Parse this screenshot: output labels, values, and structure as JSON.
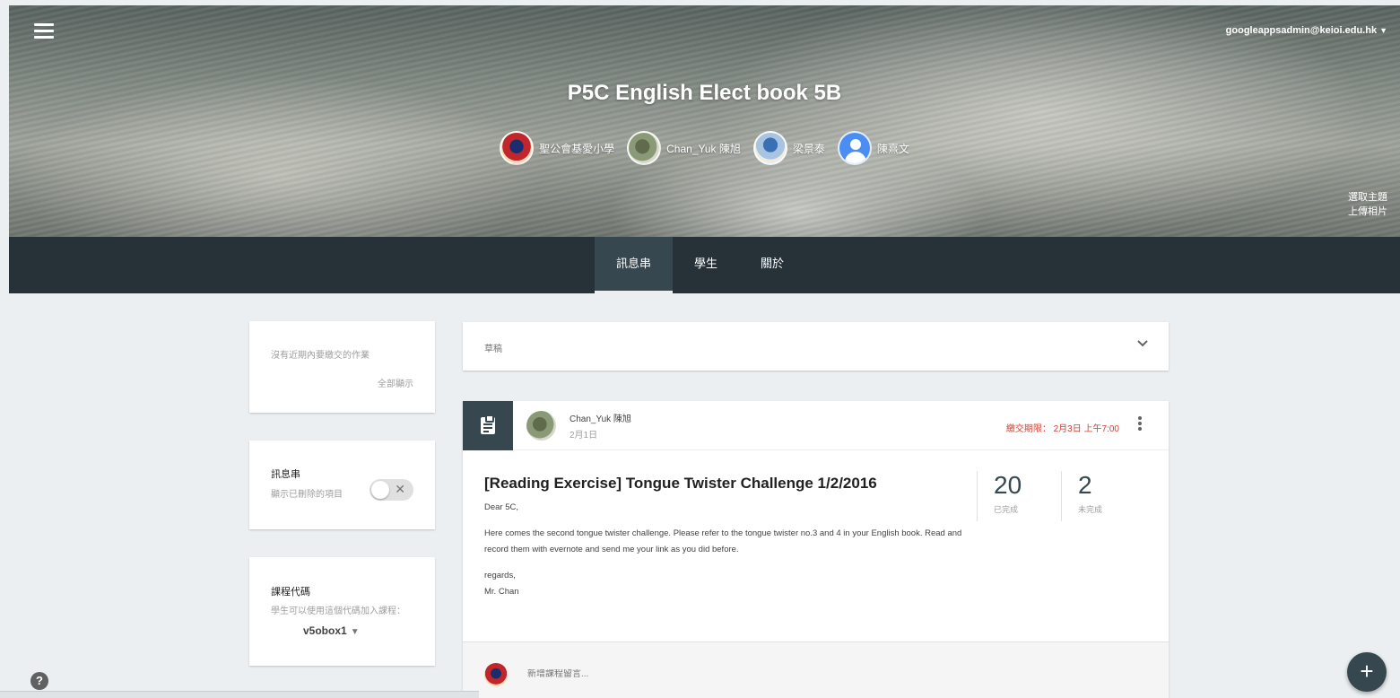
{
  "header": {
    "account_email": "googleappsadmin@keioi.edu.hk",
    "course_title": "P5C English Elect book 5B",
    "teachers": [
      {
        "name": "聖公會基愛小學"
      },
      {
        "name": "Chan_Yuk 陳旭"
      },
      {
        "name": "梁景泰"
      },
      {
        "name": "陳熹文"
      }
    ],
    "select_theme": "選取主題",
    "upload_photo": "上傳相片"
  },
  "tabs": [
    {
      "label": "訊息串",
      "active": true
    },
    {
      "label": "學生",
      "active": false
    },
    {
      "label": "關於",
      "active": false
    }
  ],
  "sidebar": {
    "upcoming": {
      "text": "沒有近期內要繳交的作業",
      "show_all": "全部顯示"
    },
    "stream": {
      "title": "訊息串",
      "show_deleted": "顯示已刪除的項目",
      "toggle_on": false
    },
    "class_code": {
      "title": "課程代碼",
      "hint": "學生可以使用這個代碼加入課程：",
      "code": "v5obox1"
    }
  },
  "drafts": {
    "label": "草稿"
  },
  "post": {
    "author": "Chan_Yuk 陳旭",
    "date": "2月1日",
    "due": "繳交期限： 2月3日 上午7:00",
    "title": "[Reading Exercise] Tongue Twister Challenge 1/2/2016",
    "greeting": "Dear 5C,",
    "body": "Here comes the second tongue twister challenge. Please refer to the tongue twister no.3 and 4 in your English book. Read and record them with evernote and send me your link as you did before.",
    "signoff_1": "regards,",
    "signoff_2": "Mr. Chan",
    "stats": {
      "done_count": "20",
      "done_label": "已完成",
      "not_done_count": "2",
      "not_done_label": "未完成"
    }
  },
  "comment": {
    "placeholder": "新增課程留言..."
  },
  "colors": {
    "tab_bar": "#263238",
    "assignment_icon_bg": "#37474f",
    "due_text": "#d23f31",
    "page_bg": "#eceff1"
  },
  "icons": [
    "menu-icon",
    "chevron-down-icon",
    "assignment-icon",
    "more-vert-icon",
    "help-icon",
    "add-icon"
  ]
}
